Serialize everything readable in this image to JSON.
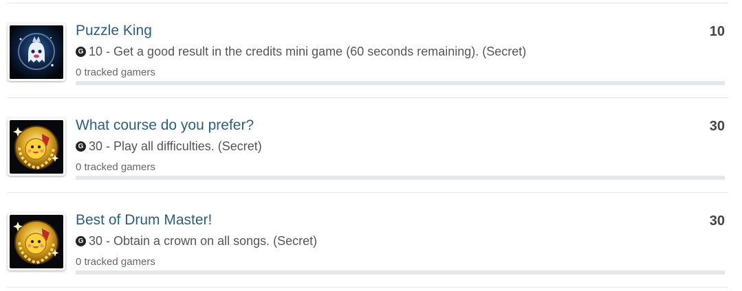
{
  "achievements": [
    {
      "title": "Puzzle King",
      "score": "10",
      "gamerscore": "10",
      "description": " - Get a good result in the credits mini game (60 seconds remaining). (Secret)",
      "tracked": "0 tracked gamers",
      "progress": 0,
      "icon": "ghost-mascot-icon"
    },
    {
      "title": "What course do you prefer?",
      "score": "30",
      "gamerscore": "30",
      "description": " - Play all difficulties. (Secret)",
      "tracked": "0 tracked gamers",
      "progress": 0,
      "icon": "drum-mascot-medal-icon"
    },
    {
      "title": "Best of Drum Master!",
      "score": "30",
      "gamerscore": "30",
      "description": " - Obtain a crown on all songs. (Secret)",
      "tracked": "0 tracked gamers",
      "progress": 0,
      "icon": "drum-mascot-medal-icon"
    }
  ],
  "gamerscore_glyph": "G"
}
